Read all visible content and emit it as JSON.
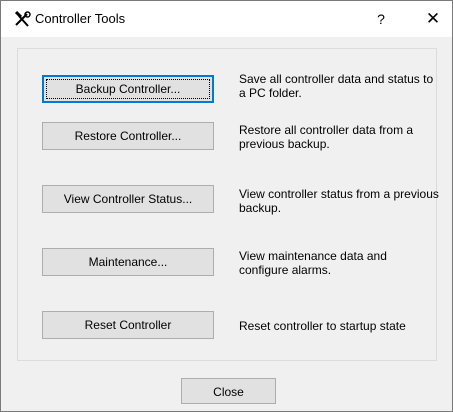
{
  "window": {
    "title": "Controller Tools",
    "help_glyph": "?",
    "close_glyph": "✕"
  },
  "tools": [
    {
      "button_label": "Backup Controller...",
      "description": "Save all controller data and status to a PC folder."
    },
    {
      "button_label": "Restore Controller...",
      "description": "Restore all controller data from a previous backup."
    },
    {
      "button_label": "View Controller Status...",
      "description": "View controller status from a previous backup."
    },
    {
      "button_label": "Maintenance...",
      "description": "View maintenance data and configure alarms."
    },
    {
      "button_label": "Reset Controller",
      "description": "Reset controller to startup state"
    }
  ],
  "footer": {
    "close_label": "Close"
  },
  "icons": {
    "title_icon": "tools-icon"
  },
  "colors": {
    "dialog_bg": "#f0f0f0",
    "titlebar_bg": "#ffffff",
    "button_bg": "#e1e1e1",
    "button_border": "#adadad",
    "focus_border": "#0078d7"
  }
}
